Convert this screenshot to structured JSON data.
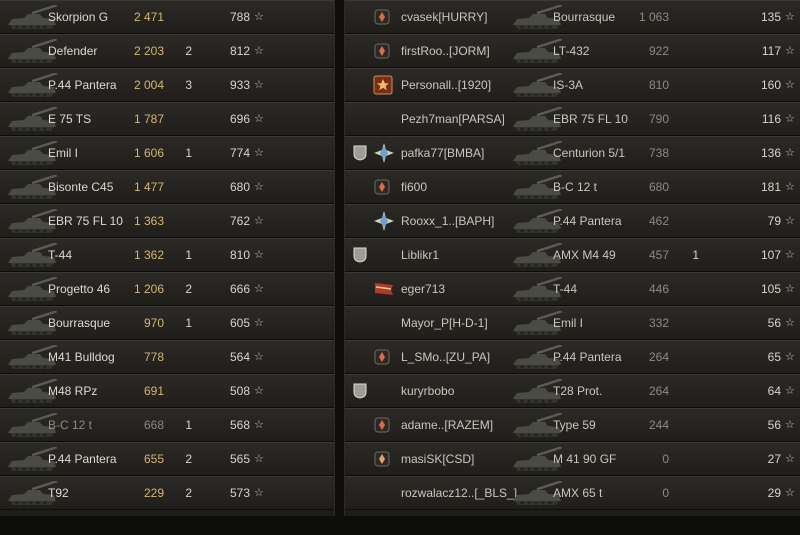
{
  "colors": {
    "damage_left": "#d6b76a",
    "damage_right": "#8b8a82",
    "text": "#dbdad2",
    "row_bg": "#2b2a26"
  },
  "team_left": [
    {
      "tank": "Skorpion G",
      "damage": "2 471",
      "kills": "",
      "xp": "788",
      "star": "☆"
    },
    {
      "tank": "Defender",
      "damage": "2 203",
      "kills": "2",
      "xp": "812",
      "star": "☆"
    },
    {
      "tank": "P.44 Pantera",
      "damage": "2 004",
      "kills": "3",
      "xp": "933",
      "star": "☆"
    },
    {
      "tank": "E 75 TS",
      "damage": "1 787",
      "kills": "",
      "xp": "696",
      "star": "☆"
    },
    {
      "tank": "Emil I",
      "damage": "1 606",
      "kills": "1",
      "xp": "774",
      "star": "☆"
    },
    {
      "tank": "Bisonte C45",
      "damage": "1 477",
      "kills": "",
      "xp": "680",
      "star": "☆"
    },
    {
      "tank": "EBR 75 FL 10",
      "damage": "1 363",
      "kills": "",
      "xp": "762",
      "star": "☆"
    },
    {
      "tank": "T-44",
      "damage": "1 362",
      "kills": "1",
      "xp": "810",
      "star": "☆"
    },
    {
      "tank": "Progetto 46",
      "damage": "1 206",
      "kills": "2",
      "xp": "666",
      "star": "☆"
    },
    {
      "tank": "Bourrasque",
      "damage": "970",
      "kills": "1",
      "xp": "605",
      "star": "☆"
    },
    {
      "tank": "M41 Bulldog",
      "damage": "778",
      "kills": "",
      "xp": "564",
      "star": "☆"
    },
    {
      "tank": "M48 RPz",
      "damage": "691",
      "kills": "",
      "xp": "508",
      "star": "☆"
    },
    {
      "tank": "B-C 12 t",
      "damage": "668",
      "kills": "1",
      "xp": "568",
      "star": "☆"
    },
    {
      "tank": "P.44 Pantera",
      "damage": "655",
      "kills": "2",
      "xp": "565",
      "star": "☆"
    },
    {
      "tank": "T92",
      "damage": "229",
      "kills": "2",
      "xp": "573",
      "star": "☆"
    }
  ],
  "team_right": [
    {
      "badge": "",
      "rank": "diamond",
      "player": "cvasek[HURRY]",
      "tank": "Bourrasque",
      "damage": "1 063",
      "kills": "",
      "xp": "135",
      "star": "☆"
    },
    {
      "badge": "",
      "rank": "diamond",
      "player": "firstRoo..[JORM]",
      "tank": "LT-432",
      "damage": "922",
      "kills": "",
      "xp": "117",
      "star": "☆"
    },
    {
      "badge": "",
      "rank": "star",
      "player": "Personall..[1920]",
      "tank": "IS-3A",
      "damage": "810",
      "kills": "",
      "xp": "160",
      "star": "☆"
    },
    {
      "badge": "",
      "rank": "",
      "player": "Pezh7man[PARSA]",
      "tank": "EBR 75 FL 10",
      "damage": "790",
      "kills": "",
      "xp": "116",
      "star": "☆"
    },
    {
      "badge": "shield",
      "rank": "burst",
      "player": "pafka77[BMBA]",
      "tank": "Centurion 5/1",
      "damage": "738",
      "kills": "",
      "xp": "136",
      "star": "☆"
    },
    {
      "badge": "",
      "rank": "diamond",
      "player": "fi600",
      "tank": "B-C 12 t",
      "damage": "680",
      "kills": "",
      "xp": "181",
      "star": "☆"
    },
    {
      "badge": "",
      "rank": "burst",
      "player": "Rooxx_1..[BAPH]",
      "tank": "P.44 Pantera",
      "damage": "462",
      "kills": "",
      "xp": "79",
      "star": "☆"
    },
    {
      "badge": "shield",
      "rank": "",
      "player": "Liblikr1",
      "tank": "AMX M4 49",
      "damage": "457",
      "kills": "1",
      "xp": "107",
      "star": "☆"
    },
    {
      "badge": "",
      "rank": "flag",
      "player": "eger713",
      "tank": "T-44",
      "damage": "446",
      "kills": "",
      "xp": "105",
      "star": "☆"
    },
    {
      "badge": "",
      "rank": "",
      "player": "Mayor_P[H-D-1]",
      "tank": "Emil I",
      "damage": "332",
      "kills": "",
      "xp": "56",
      "star": "☆"
    },
    {
      "badge": "",
      "rank": "diamond",
      "player": "L_SMo..[ZU_PA]",
      "tank": "P.44 Pantera",
      "damage": "264",
      "kills": "",
      "xp": "65",
      "star": "☆"
    },
    {
      "badge": "shield",
      "rank": "",
      "player": "kuryrbobo",
      "tank": "T28 Prot.",
      "damage": "264",
      "kills": "",
      "xp": "64",
      "star": "☆"
    },
    {
      "badge": "",
      "rank": "diamond",
      "player": "adame..[RAZEM]",
      "tank": "Type 59",
      "damage": "244",
      "kills": "",
      "xp": "56",
      "star": "☆"
    },
    {
      "badge": "",
      "rank": "diamond-2",
      "player": "masiSK[CSD]",
      "tank": "M 41 90 GF",
      "damage": "0",
      "kills": "",
      "xp": "27",
      "star": "☆"
    },
    {
      "badge": "",
      "rank": "",
      "player": "rozwalacz12..[_BLS_]",
      "tank": "AMX 65 t",
      "damage": "0",
      "kills": "",
      "xp": "29",
      "star": "☆"
    }
  ]
}
